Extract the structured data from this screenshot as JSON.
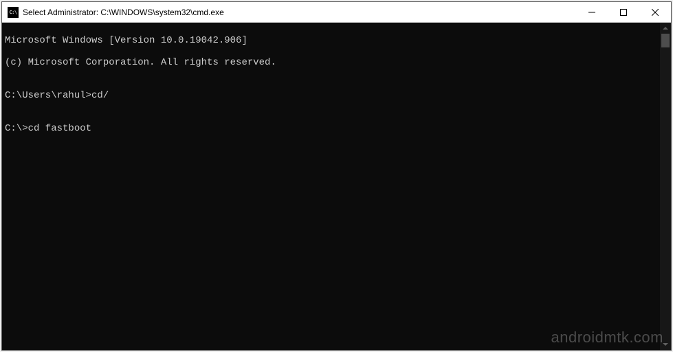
{
  "titlebar": {
    "icon_label": "C:\\",
    "title": "Select Administrator: C:\\WINDOWS\\system32\\cmd.exe"
  },
  "terminal": {
    "lines": {
      "l0": "Microsoft Windows [Version 10.0.19042.906]",
      "l1": "(c) Microsoft Corporation. All rights reserved.",
      "l2": "",
      "l3": "C:\\Users\\rahul>cd/",
      "l4": "",
      "l5": "C:\\>cd fastboot"
    }
  },
  "watermark": "androidmtk.com"
}
